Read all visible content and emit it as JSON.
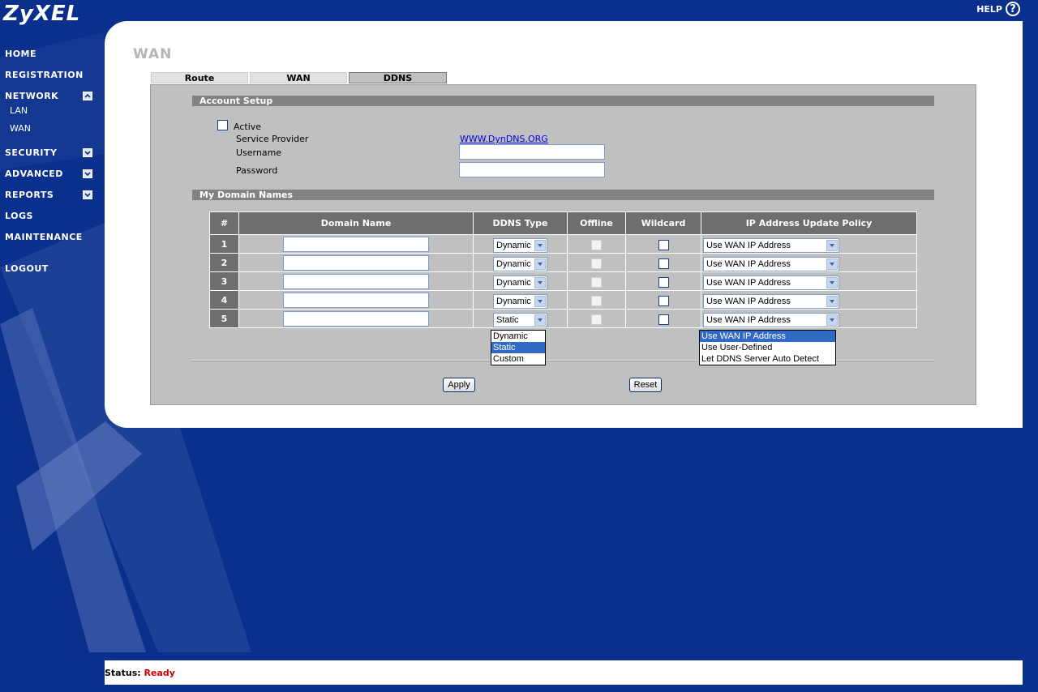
{
  "header": {
    "logo_text": "ZyXEL",
    "help_label": "HELP",
    "help_icon": "?"
  },
  "sidebar": {
    "items": [
      {
        "label": "HOME"
      },
      {
        "label": "REGISTRATION"
      },
      {
        "label": "NETWORK"
      },
      {
        "label": "LAN"
      },
      {
        "label": "WAN"
      },
      {
        "label": "SECURITY"
      },
      {
        "label": "ADVANCED"
      },
      {
        "label": "REPORTS"
      },
      {
        "label": "LOGS"
      },
      {
        "label": "MAINTENANCE"
      },
      {
        "label": "LOGOUT"
      }
    ]
  },
  "page": {
    "title": "WAN"
  },
  "tabs": [
    {
      "label": "Route"
    },
    {
      "label": "WAN"
    },
    {
      "label": "DDNS",
      "active": true
    }
  ],
  "account_setup": {
    "section_title": "Account Setup",
    "active_label": "Active",
    "active_checked": false,
    "service_provider_label": "Service Provider",
    "service_provider_value": "WWW.DynDNS.ORG",
    "username_label": "Username",
    "username_value": "",
    "password_label": "Password",
    "password_value": ""
  },
  "domains": {
    "section_title": "My Domain Names",
    "columns": [
      "#",
      "Domain Name",
      "DDNS Type",
      "Offline",
      "Wildcard",
      "IP Address Update Policy"
    ],
    "rows": [
      {
        "num": "1",
        "domain": "",
        "ddns_type": "Dynamic",
        "policy": "Use WAN IP Address"
      },
      {
        "num": "2",
        "domain": "",
        "ddns_type": "Dynamic",
        "policy": "Use WAN IP Address"
      },
      {
        "num": "3",
        "domain": "",
        "ddns_type": "Dynamic",
        "policy": "Use WAN IP Address"
      },
      {
        "num": "4",
        "domain": "",
        "ddns_type": "Dynamic",
        "policy": "Use WAN IP Address"
      },
      {
        "num": "5",
        "domain": "",
        "ddns_type": "Static",
        "policy": "Use WAN IP Address"
      }
    ],
    "ddns_type_options": [
      "Dynamic",
      "Static",
      "Custom"
    ],
    "ddns_type_highlighted": "Static",
    "policy_options": [
      "Use WAN IP Address",
      "Use User-Defined",
      "Let DDNS Server Auto Detect"
    ],
    "policy_highlighted": "Use WAN IP Address"
  },
  "buttons": {
    "apply": "Apply",
    "reset": "Reset"
  },
  "status": {
    "label": "Status:",
    "value": "Ready"
  },
  "colors": {
    "background": "#0a2f8c",
    "panel": "#ffffff",
    "content": "#c0c0c0",
    "header_cell": "#6e6e6e",
    "status_ready": "#cc0000",
    "highlight": "#316ac5"
  }
}
